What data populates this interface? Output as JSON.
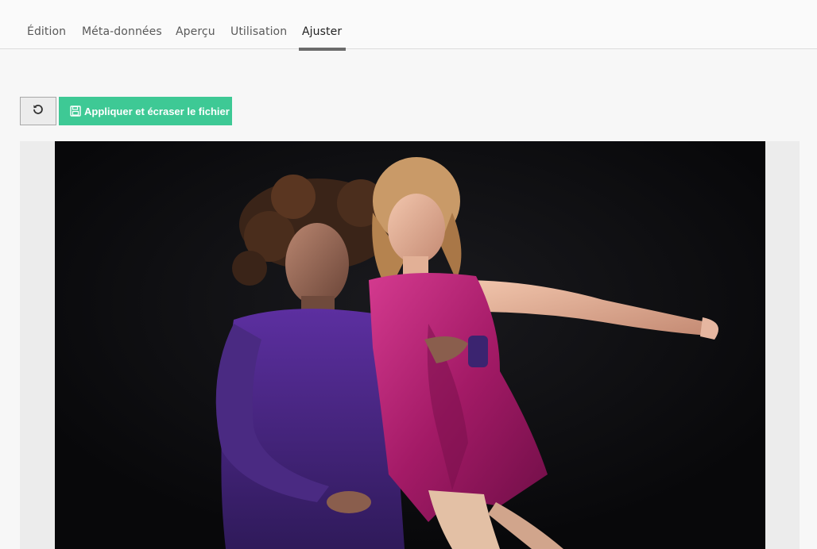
{
  "tabs": [
    {
      "label": "Édition"
    },
    {
      "label": "Méta-données"
    },
    {
      "label": "Aperçu"
    },
    {
      "label": "Utilisation"
    },
    {
      "label": "Ajuster"
    }
  ],
  "active_tab": "Ajuster",
  "toolbar": {
    "reset_icon": "undo-icon",
    "apply_label": "Appliquer et écraser le fichier",
    "apply_icon": "floppy-disk-icon"
  },
  "colors": {
    "accent": "#3ec995",
    "photo_background": "#0b0b0d"
  }
}
